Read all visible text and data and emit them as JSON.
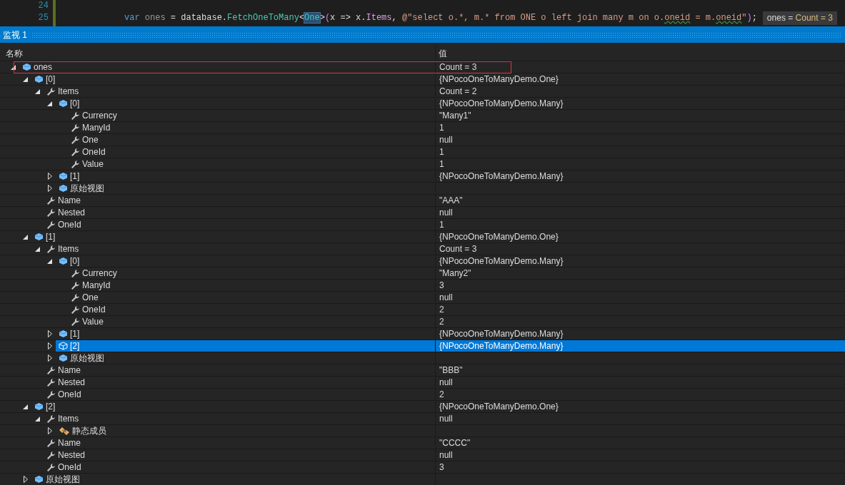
{
  "editor": {
    "lines": [
      {
        "number": "24"
      },
      {
        "number": "25",
        "tokens": [
          {
            "kind": "keyword",
            "text": "var"
          },
          {
            "kind": "local",
            "text": " ones"
          },
          {
            "kind": "plain",
            "text": " = database."
          },
          {
            "kind": "method",
            "text": "FetchOneToMany"
          },
          {
            "kind": "plain",
            "text": "<"
          },
          {
            "kind": "type-ref",
            "text": "One"
          },
          {
            "kind": "plain",
            "text": ">"
          },
          {
            "kind": "paren",
            "text": "("
          },
          {
            "kind": "plain",
            "text": "x => x."
          },
          {
            "kind": "member",
            "text": "Items"
          },
          {
            "kind": "plain",
            "text": ", "
          },
          {
            "kind": "string",
            "text": "@\"select o.*, m.* from ONE o left join many m on o."
          },
          {
            "kind": "string-warn",
            "text": "oneid"
          },
          {
            "kind": "string",
            "text": " = m."
          },
          {
            "kind": "string-warn",
            "text": "oneid"
          },
          {
            "kind": "string",
            "text": "\""
          },
          {
            "kind": "paren",
            "text": ")"
          },
          {
            "kind": "plain",
            "text": ";"
          }
        ]
      }
    ],
    "datatip": {
      "name": "ones =",
      "value": "Count = 3"
    }
  },
  "watch": {
    "title": "监视 1",
    "columns": [
      "名称",
      "值"
    ],
    "nodes": [
      {
        "kind": "object",
        "name": "ones",
        "value": "Count = 3",
        "expanded": true,
        "selected": false,
        "outlined": true,
        "children": [
          {
            "kind": "object",
            "name": "[0]",
            "value": "{NPocoOneToManyDemo.One}",
            "expanded": true,
            "selected": false,
            "outlined": false,
            "children": [
              {
                "kind": "property",
                "name": "Items",
                "value": "Count = 2",
                "expanded": true,
                "selected": false,
                "outlined": false,
                "children": [
                  {
                    "kind": "object",
                    "name": "[0]",
                    "value": "{NPocoOneToManyDemo.Many}",
                    "expanded": true,
                    "selected": false,
                    "outlined": false,
                    "children": [
                      {
                        "kind": "property",
                        "name": "Currency",
                        "value": "\"Many1\"",
                        "selected": false,
                        "outlined": false
                      },
                      {
                        "kind": "property",
                        "name": "ManyId",
                        "value": "1",
                        "selected": false,
                        "outlined": false
                      },
                      {
                        "kind": "property",
                        "name": "One",
                        "value": "null",
                        "selected": false,
                        "outlined": false
                      },
                      {
                        "kind": "property",
                        "name": "OneId",
                        "value": "1",
                        "selected": false,
                        "outlined": false
                      },
                      {
                        "kind": "property",
                        "name": "Value",
                        "value": "1",
                        "selected": false,
                        "outlined": false
                      }
                    ]
                  },
                  {
                    "kind": "object",
                    "name": "[1]",
                    "value": "{NPocoOneToManyDemo.Many}",
                    "expanded": false,
                    "selected": false,
                    "outlined": false
                  },
                  {
                    "kind": "object",
                    "name": "原始视图",
                    "expanded": false,
                    "selected": false,
                    "outlined": false
                  }
                ]
              },
              {
                "kind": "property",
                "name": "Name",
                "value": "\"AAA\"",
                "selected": false,
                "outlined": false
              },
              {
                "kind": "property",
                "name": "Nested",
                "value": "null",
                "selected": false,
                "outlined": false
              },
              {
                "kind": "property",
                "name": "OneId",
                "value": "1",
                "selected": false,
                "outlined": false
              }
            ]
          },
          {
            "kind": "object",
            "name": "[1]",
            "value": "{NPocoOneToManyDemo.One}",
            "expanded": true,
            "selected": false,
            "outlined": false,
            "children": [
              {
                "kind": "property",
                "name": "Items",
                "value": "Count = 3",
                "expanded": true,
                "selected": false,
                "outlined": false,
                "children": [
                  {
                    "kind": "object",
                    "name": "[0]",
                    "value": "{NPocoOneToManyDemo.Many}",
                    "expanded": true,
                    "selected": false,
                    "outlined": false,
                    "children": [
                      {
                        "kind": "property",
                        "name": "Currency",
                        "value": "\"Many2\"",
                        "selected": false,
                        "outlined": false
                      },
                      {
                        "kind": "property",
                        "name": "ManyId",
                        "value": "3",
                        "selected": false,
                        "outlined": false
                      },
                      {
                        "kind": "property",
                        "name": "One",
                        "value": "null",
                        "selected": false,
                        "outlined": false
                      },
                      {
                        "kind": "property",
                        "name": "OneId",
                        "value": "2",
                        "selected": false,
                        "outlined": false
                      },
                      {
                        "kind": "property",
                        "name": "Value",
                        "value": "2",
                        "selected": false,
                        "outlined": false
                      }
                    ]
                  },
                  {
                    "kind": "object",
                    "name": "[1]",
                    "value": "{NPocoOneToManyDemo.Many}",
                    "expanded": false,
                    "selected": false,
                    "outlined": false
                  },
                  {
                    "kind": "object",
                    "name": "[2]",
                    "value": "{NPocoOneToManyDemo.Many}",
                    "expanded": false,
                    "selected": true,
                    "outlined": false
                  },
                  {
                    "kind": "object",
                    "name": "原始视图",
                    "expanded": false,
                    "selected": false,
                    "outlined": false
                  }
                ]
              },
              {
                "kind": "property",
                "name": "Name",
                "value": "\"BBB\"",
                "selected": false,
                "outlined": false
              },
              {
                "kind": "property",
                "name": "Nested",
                "value": "null",
                "selected": false,
                "outlined": false
              },
              {
                "kind": "property",
                "name": "OneId",
                "value": "2",
                "selected": false,
                "outlined": false
              }
            ]
          },
          {
            "kind": "object",
            "name": "[2]",
            "value": "{NPocoOneToManyDemo.One}",
            "expanded": true,
            "selected": false,
            "outlined": false,
            "children": [
              {
                "kind": "property",
                "name": "Items",
                "value": "null",
                "expanded": true,
                "selected": false,
                "outlined": false,
                "children": [
                  {
                    "kind": "static",
                    "name": "静态成员",
                    "expanded": false,
                    "selected": false,
                    "outlined": false
                  }
                ]
              },
              {
                "kind": "property",
                "name": "Name",
                "value": "\"CCCC\"",
                "selected": false,
                "outlined": false
              },
              {
                "kind": "property",
                "name": "Nested",
                "value": "null",
                "selected": false,
                "outlined": false
              },
              {
                "kind": "property",
                "name": "OneId",
                "value": "3",
                "selected": false,
                "outlined": false
              }
            ]
          },
          {
            "kind": "object",
            "name": "原始视图",
            "expanded": false,
            "selected": false,
            "outlined": false
          }
        ]
      }
    ]
  }
}
